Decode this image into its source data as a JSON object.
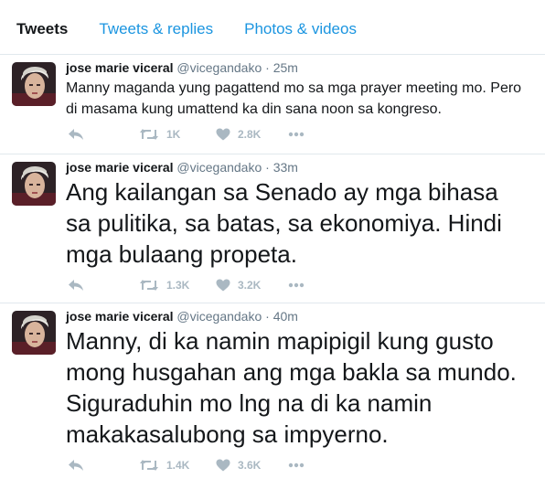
{
  "tabs": [
    {
      "label": "Tweets"
    },
    {
      "label": "Tweets & replies"
    },
    {
      "label": "Photos & videos"
    }
  ],
  "tweets": [
    {
      "name": "jose marie viceral",
      "handle": "@vicegandako",
      "separator": "·",
      "time": "25m",
      "text": "Manny maganda yung pagattend mo sa mga prayer meeting mo. Pero di masama kung umattend ka din sana noon sa kongreso.",
      "retweets": "1K",
      "likes": "2.8K"
    },
    {
      "name": "jose marie viceral",
      "handle": "@vicegandako",
      "separator": "·",
      "time": "33m",
      "text": "Ang kailangan sa Senado ay mga bihasa sa pulitika, sa batas, sa ekonomiya. Hindi mga bulaang propeta.",
      "retweets": "1.3K",
      "likes": "3.2K"
    },
    {
      "name": "jose marie viceral",
      "handle": "@vicegandako",
      "separator": "·",
      "time": "40m",
      "text": "Manny, di ka namin mapipigil kung gusto mong husgahan ang mga bakla sa mundo. Siguraduhin mo lng na di ka namin makakasalubong sa impyerno.",
      "retweets": "1.4K",
      "likes": "3.6K"
    }
  ],
  "icons": {
    "reply": "reply-icon",
    "retweet": "retweet-icon",
    "like": "heart-icon",
    "more": "more-icon"
  },
  "colors": {
    "accent": "#1b95e0",
    "muted": "#657786",
    "action": "#aab8c2",
    "divider": "#e1e8ed"
  }
}
